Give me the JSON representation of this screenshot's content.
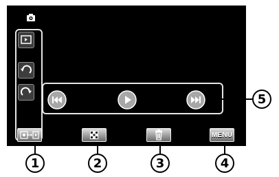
{
  "colors": {
    "screen_bg": "#000000",
    "outline": "#e5e5e5",
    "button_dark": "#3d3d3d",
    "button_border": "#8f8f8f",
    "play_button_fill": "#a7a7a7",
    "bar_button_top": "#dcdcdc",
    "bar_button_bottom": "#6a6a6a",
    "callout_text": "#000000"
  },
  "icons": {
    "mode": "camera-icon",
    "play_mode": "play-mode-icon",
    "rotate_left": "rotate-left-icon",
    "rotate_right": "rotate-right-icon",
    "prev": "skip-previous-icon",
    "play": "play-icon",
    "next": "skip-next-icon",
    "mode_switch": "mode-switch-icon",
    "index": "index-grid-icon",
    "delete": "trash-icon"
  },
  "bottom_bar": {
    "menu_label": "MENU"
  },
  "callouts": {
    "c1": "1",
    "c2": "2",
    "c3": "3",
    "c4": "4",
    "c5": "5"
  }
}
